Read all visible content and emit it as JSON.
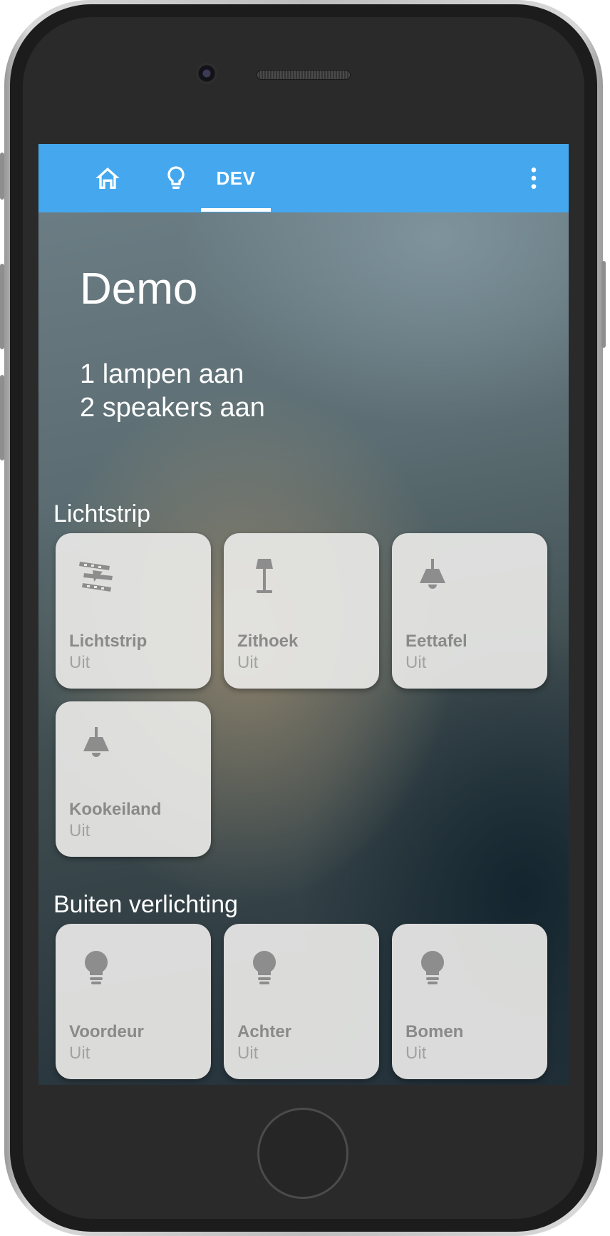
{
  "app": {
    "tabs": [
      {
        "icon": "home-icon"
      },
      {
        "icon": "lightbulb-outline-icon"
      },
      {
        "label": "DEV",
        "active": true
      }
    ],
    "menu_icon": "more-vert-icon",
    "accent_color": "#45a8ee"
  },
  "header": {
    "title": "Demo",
    "summary": [
      "1 lampen aan",
      "2 speakers aan"
    ]
  },
  "sections": [
    {
      "title": "Lichtstrip",
      "cards": [
        {
          "name": "Lichtstrip",
          "state": "Uit",
          "icon": "led-strip-icon"
        },
        {
          "name": "Zithoek",
          "state": "Uit",
          "icon": "floor-lamp-icon"
        },
        {
          "name": "Eettafel",
          "state": "Uit",
          "icon": "ceiling-lamp-icon"
        },
        {
          "name": "Kookeiland",
          "state": "Uit",
          "icon": "ceiling-lamp-icon"
        }
      ]
    },
    {
      "title": "Buiten verlichting",
      "cards": [
        {
          "name": "Voordeur",
          "state": "Uit",
          "icon": "lightbulb-icon"
        },
        {
          "name": "Achter",
          "state": "Uit",
          "icon": "lightbulb-icon"
        },
        {
          "name": "Bomen",
          "state": "Uit",
          "icon": "lightbulb-icon"
        }
      ]
    }
  ]
}
